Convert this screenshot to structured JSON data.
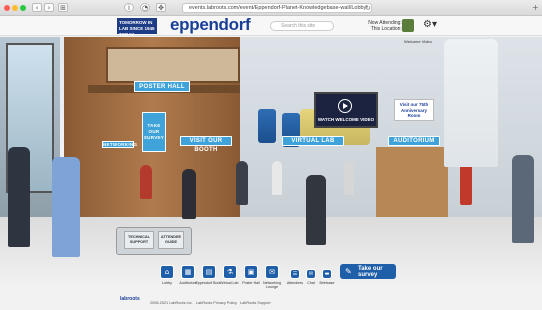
{
  "browser": {
    "url": "events.labroots.com/event/Eppendorf-Planet-Knowledgebase-wall/Lobby",
    "nav_back": "‹",
    "nav_forward": "›",
    "nav_tabs": "⊞",
    "reload": "↻",
    "new_tab": "+"
  },
  "header": {
    "logo_tagline": "TOMORROW IN LAB SINCE 1945 TODAY",
    "brand": "eppendorf",
    "search_placeholder": "Search this site",
    "now_attending": "Now Attending: 2",
    "this_location": "This Location: 2",
    "settings_glyph": "⚙▾",
    "accent_color": "#1a3f99"
  },
  "scene": {
    "signs": {
      "poster_hall": "POSTER HALL",
      "survey": "TAKE OUR SURVEY",
      "visit_booth": "VISIT OUR BOOTH",
      "virtual_lab": "VIRTUAL LAB",
      "auditorium": "AUDITORIUM",
      "networking": "NETWORKING"
    },
    "video_label": "WATCH WELCOME VIDEO",
    "anniversary": "Visit our 75th Anniversary Room",
    "welcome_video_btn": "Welcome Video",
    "desk": {
      "technical_support": "TECHNICAL SUPPORT",
      "attendee_guide": "ATTENDEE GUIDE"
    }
  },
  "bottom_nav": {
    "items": [
      {
        "label": "Lobby",
        "icon": "home-icon",
        "glyph": "⌂"
      },
      {
        "label": "Auditorium",
        "icon": "auditorium-icon",
        "glyph": "▦"
      },
      {
        "label": "Eppendorf Booth",
        "icon": "booth-icon",
        "glyph": "▤"
      },
      {
        "label": "Virtual Lab",
        "icon": "flask-icon",
        "glyph": "⚗"
      },
      {
        "label": "Poster Hall",
        "icon": "poster-icon",
        "glyph": "▣"
      },
      {
        "label": "Networking Lounge",
        "icon": "chat-icon",
        "glyph": "✉"
      }
    ],
    "secondary": [
      {
        "label": "Attendees",
        "icon": "attendees-icon",
        "glyph": "☰"
      },
      {
        "label": "Chat",
        "icon": "chat-bubble-icon",
        "glyph": "✉"
      },
      {
        "label": "Briefcase",
        "icon": "briefcase-icon",
        "glyph": "▬"
      }
    ],
    "survey_button": "Take our survey"
  },
  "footer": {
    "logo": "labroots",
    "copyright": "2008-2021 LabRoots Inc.",
    "privacy": "LabRoots Privacy Policy",
    "support": "LabRoots Support"
  }
}
